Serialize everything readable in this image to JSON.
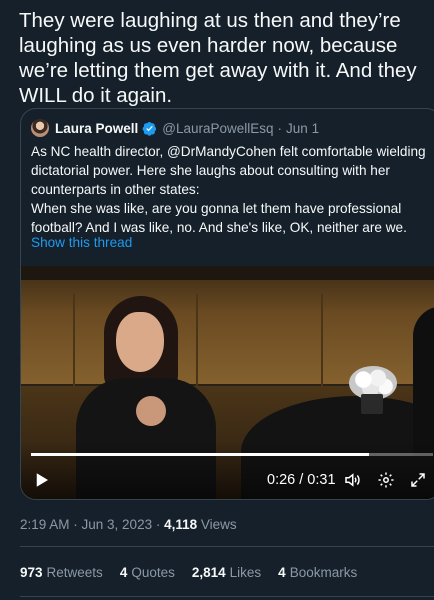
{
  "tweet": {
    "text": "They were laughing at us then and they’re laughing as us even harder now, because we’re letting them get away with it. And they WILL do it again."
  },
  "quote": {
    "name": "Laura Powell",
    "handle": "@LauraPowellEsq",
    "separator": "·",
    "date": "Jun 1",
    "body_line1": "As NC health director, @DrMandyCohen felt comfortable wielding dictatorial power. Here she laughs about consulting with her counterparts in other states:",
    "body_line2": "When she was like, are you gonna let them have professional football? And I was like, no. And she's like, OK, neither are we.",
    "show_thread": "Show this thread"
  },
  "video": {
    "time": "0:26 / 0:31",
    "progress_fraction": 0.84
  },
  "meta": {
    "timestamp": "2:19 AM · Jun 3, 2023 · ",
    "views_count": "4,118",
    "views_label": " Views"
  },
  "stats": {
    "retweets_count": "973",
    "retweets_label": "Retweets",
    "quotes_count": "4",
    "quotes_label": "Quotes",
    "likes_count": "2,814",
    "likes_label": "Likes",
    "bookmarks_count": "4",
    "bookmarks_label": "Bookmarks"
  },
  "colors": {
    "background": "#15202b",
    "border": "#38444d",
    "accent": "#1d9bf0",
    "secondary_text": "#8b98a5"
  },
  "icons": [
    "verified-badge-icon",
    "play-icon",
    "volume-icon",
    "settings-icon",
    "fullscreen-icon"
  ]
}
